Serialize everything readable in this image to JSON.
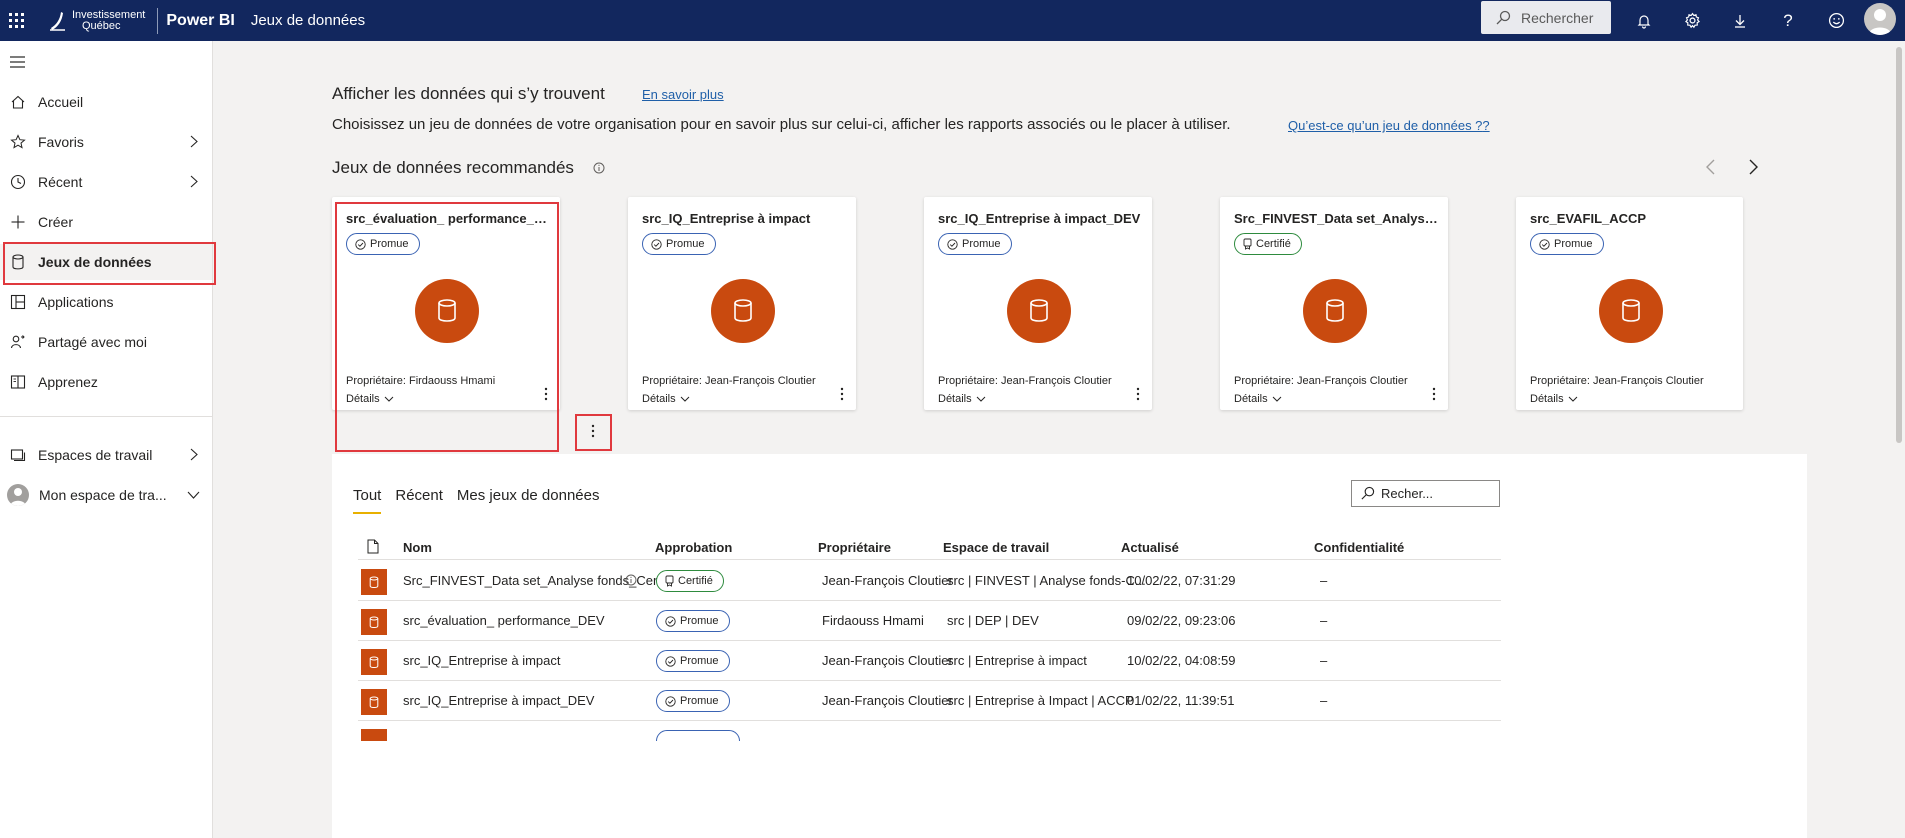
{
  "topbar": {
    "org_line1": "Investissement",
    "org_line2": "Québec",
    "brand": "Power BI",
    "breadcrumb": "Jeux de données",
    "search_label": "Rechercher"
  },
  "sidebar": {
    "items": [
      {
        "label": "Accueil",
        "icon": "home-icon"
      },
      {
        "label": "Favoris",
        "icon": "star-icon"
      },
      {
        "label": "Récent",
        "icon": "clock-icon"
      },
      {
        "label": "Créer",
        "icon": "plus-icon"
      },
      {
        "label": "Jeux de données",
        "icon": "dataset-icon"
      },
      {
        "label": "Applications",
        "icon": "apps-icon"
      },
      {
        "label": "Partagé avec moi",
        "icon": "shared-icon"
      },
      {
        "label": "Apprenez",
        "icon": "book-icon"
      },
      {
        "label": "Espaces de travail",
        "icon": "workspaces-icon"
      },
      {
        "label": "Mon espace de tra...",
        "icon": "user-avatar"
      }
    ]
  },
  "header": {
    "title": "Afficher les données qui s’y trouvent",
    "learn_more": "En savoir plus",
    "description": "Choisissez un jeu de données de votre organisation pour en savoir plus sur celui-ci, afficher les rapports associés ou le placer à utiliser.",
    "what_is_link": "Qu’est-ce qu’un jeu de données ?",
    "what_is_suffix": "?"
  },
  "recommended": {
    "title": "Jeux de données recommandés",
    "cards": [
      {
        "title": "src_évaluation_ performance_DEV",
        "badge": "Promue",
        "owner": "Propriétaire: Firdaouss Hmami",
        "details": "Détails"
      },
      {
        "title": "src_IQ_Entreprise à impact",
        "badge": "Promue",
        "owner": "Propriétaire: Jean-François Cloutier",
        "details": "Détails"
      },
      {
        "title": "src_IQ_Entreprise à impact_DEV",
        "badge": "Promue",
        "owner": "Propriétaire: Jean-François Cloutier",
        "details": "Détails"
      },
      {
        "title": "Src_FINVEST_Data set_Analyse fonds_…",
        "badge": "Certifié",
        "owner": "Propriétaire: Jean-François Cloutier",
        "details": "Détails"
      },
      {
        "title": "src_EVAFIL_ACCP",
        "badge": "Promue",
        "owner": "Propriétaire: Jean-François Cloutier",
        "details": "Détails"
      }
    ]
  },
  "list": {
    "tabs": [
      "Tout",
      "Récent",
      "Mes jeux de données"
    ],
    "search_placeholder": "Recher...",
    "columns": [
      "Nom",
      "Approbation",
      "Propriétaire",
      "Espace de travail",
      "Actualisé",
      "Confidentialité"
    ],
    "rows": [
      {
        "name": "Src_FINVEST_Data set_Analyse fonds_Cer...",
        "approval": "Certifié",
        "owner": "Jean-François Cloutier",
        "workspace": "src | FINVEST | Analyse fonds-C...",
        "refreshed": "10/02/22, 07:31:29",
        "sensitivity": "–"
      },
      {
        "name": "src_évaluation_ performance_DEV",
        "approval": "Promue",
        "owner": "Firdaouss Hmami",
        "workspace": "src | DEP | DEV",
        "refreshed": "09/02/22, 09:23:06",
        "sensitivity": "–"
      },
      {
        "name": "src_IQ_Entreprise à impact",
        "approval": "Promue",
        "owner": "Jean-François Cloutier",
        "workspace": "src | Entreprise à impact",
        "refreshed": "10/02/22, 04:08:59",
        "sensitivity": "–"
      },
      {
        "name": "src_IQ_Entreprise à impact_DEV",
        "approval": "Promue",
        "owner": "Jean-François Cloutier",
        "workspace": "src | Entreprise à Impact | ACCP",
        "refreshed": "01/02/22, 11:39:51",
        "sensitivity": "–"
      }
    ]
  },
  "colors": {
    "topbar": "#12275e",
    "dataset_orange": "#c94a0f",
    "promoted_border": "#3a63b3",
    "certified_border": "#2e8b3e",
    "highlight_red": "#e0393e"
  }
}
